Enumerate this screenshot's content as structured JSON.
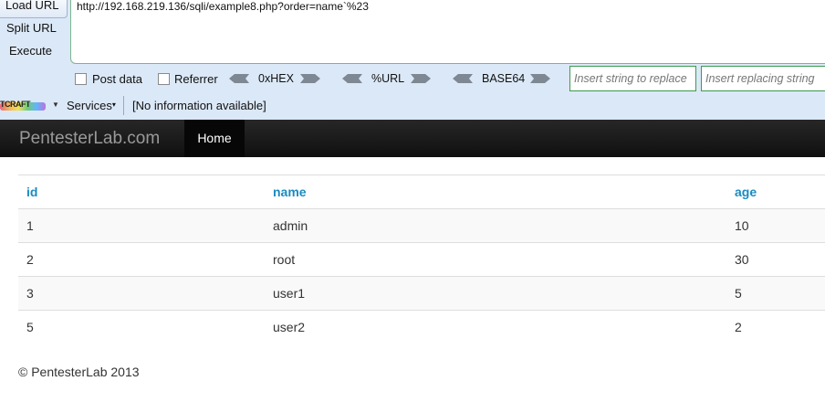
{
  "hackbar": {
    "load_url": "Load URL",
    "split_url": "Split URL",
    "execute": "Execute",
    "url": "http://192.168.219.136/sqli/example8.php?order=name`%23",
    "post_data": "Post data",
    "referrer": "Referrer",
    "hex": "0xHEX",
    "urlenc": "%URL",
    "base64": "BASE64",
    "replace_placeholder": "Insert string to replace",
    "replacing_placeholder": "Insert replacing string"
  },
  "services_bar": {
    "netcraft": "TCRAFT",
    "services": "Services",
    "info": "[No information available]"
  },
  "navbar": {
    "brand": "PentesterLab.com",
    "home": "Home"
  },
  "table": {
    "headers": [
      "id",
      "name",
      "age"
    ],
    "rows": [
      [
        "1",
        "admin",
        "10"
      ],
      [
        "2",
        "root",
        "30"
      ],
      [
        "3",
        "user1",
        "5"
      ],
      [
        "5",
        "user2",
        "2"
      ]
    ]
  },
  "footer": "© PentesterLab 2013",
  "colors": {
    "toolbar_bg": "#dbe8f7",
    "navbar_bg": "#1b1b1b",
    "header_link": "#1a8bc0",
    "input_border": "#3d9a4e"
  }
}
